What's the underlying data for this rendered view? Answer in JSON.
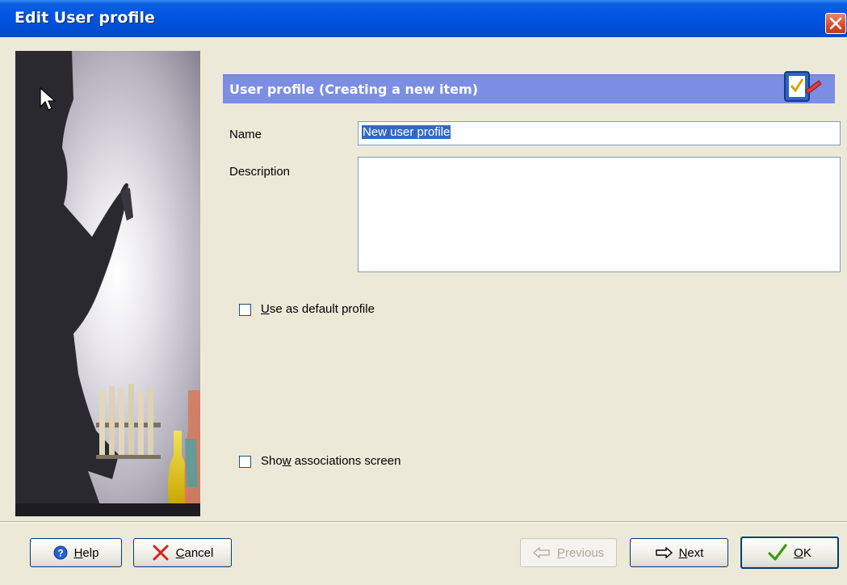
{
  "window": {
    "title": "Edit User profile"
  },
  "header": {
    "title": "User profile (Creating a new item)",
    "icon": "checklist-icon"
  },
  "form": {
    "name_label": "Name",
    "name_value": "New user profile",
    "description_label": "Description",
    "description_value": "",
    "default_profile": {
      "prefix": "",
      "mnemonic": "U",
      "suffix": "se as default profile",
      "checked": false
    },
    "show_associations": {
      "prefix": "Sho",
      "mnemonic": "w",
      "suffix": " associations screen",
      "checked": false
    }
  },
  "buttons": {
    "help": {
      "mnemonic": "H",
      "rest": "elp",
      "icon": "help-icon"
    },
    "cancel": {
      "mnemonic": "C",
      "rest": "ancel",
      "icon": "cancel-x-icon"
    },
    "previous": {
      "mnemonic": "P",
      "rest": "revious",
      "icon": "arrow-left-icon",
      "enabled": false
    },
    "next": {
      "mnemonic": "N",
      "rest": "ext",
      "icon": "arrow-right-icon"
    },
    "ok": {
      "mnemonic": "O",
      "rest": "K",
      "icon": "checkmark-icon"
    }
  },
  "colors": {
    "titlebar": "#0054e3",
    "header_band": "#7b8ee4",
    "dialog_bg": "#ece9d8"
  }
}
